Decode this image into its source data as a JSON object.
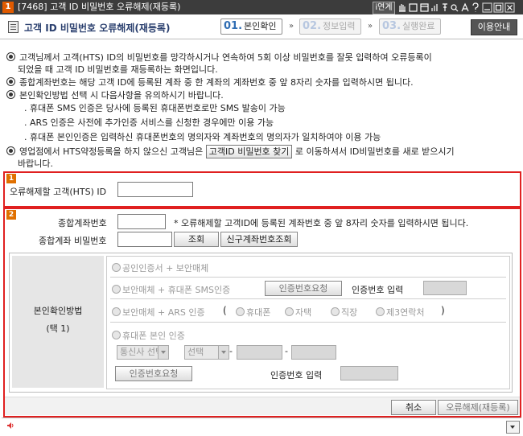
{
  "window": {
    "number": "1",
    "title": "[7468] 고객 ID 비밀번호 오류해제(재등록)",
    "toolbar_label": "i연계",
    "toolbar_icons": [
      "hand-icon",
      "box-icon",
      "square-icon",
      "chart-icon",
      "pin-icon",
      "zoom-icon",
      "letter-a-icon",
      "question-icon",
      "minimize-icon",
      "maximize-icon",
      "close-icon"
    ]
  },
  "header": {
    "page_title": "고객 ID 비밀번호 오류해제(재등록)",
    "steps": [
      {
        "num": "01.",
        "label": "본인확인",
        "active": true
      },
      {
        "num": "02.",
        "label": "정보입력",
        "active": false
      },
      {
        "num": "03.",
        "label": "실행완료",
        "active": false
      }
    ],
    "arrow": "»",
    "guide_button": "이용안내"
  },
  "info": {
    "line1": "고객님께서 고객(HTS) ID의 비밀번호를 망각하시거나 연속하여 5회 이상 비밀번호를 잘못 입력하여 오류등록이",
    "line1b": "되었을 때 고객 ID 비밀번호를 재등록하는 화면입니다.",
    "line2": "종합계좌번호는 해당 고객 ID에 등록된 계좌 중 한 계좌의 계좌번호 중 앞 8자리 숫자를 입력하시면 됩니다.",
    "line3": "본인확인방법 선택 시 다음사항을 유의하시기 바랍니다.",
    "sub1": ". 휴대폰 SMS 인증은 당사에 등록된 휴대폰번호로만 SMS 발송이 가능",
    "sub2": ". ARS 인증은 사전에 추가인증 서비스를 신청한 경우에만 이용 가능",
    "sub3": ". 휴대폰 본인인증은 입력하신 휴대폰번호의 명의자와 계좌번호의 명의자가 일치하여야 이용 가능",
    "line4a": "영업점에서 HTS약정등록을 하지 않으신 고객님은",
    "line4_button": "고객ID 비밀번호 찾기",
    "line4b": "로 이동하셔서 ID비밀번호를 새로 받으시기",
    "line4c": "바랍니다."
  },
  "section1": {
    "badge": "1",
    "label": "오류해제할 고객(HTS) ID",
    "value": ""
  },
  "section2": {
    "badge": "2",
    "account_label": "종합계좌번호",
    "account_value": "",
    "account_note": "* 오류해제할 고객ID에 등록된 계좌번호 중 앞 8자리 숫자를 입력하시면 됩니다.",
    "password_label": "종합계좌 비밀번호",
    "password_value": "",
    "lookup_button": "조회",
    "new_account_button": "신구계좌번호조회",
    "method_label": "본인확인방법",
    "method_choice": "(택 1)",
    "options": {
      "cert": "공인인증서 + 보안매체",
      "sms": "보안매체 + 휴대폰 SMS인증",
      "sms_request_button": "인증번호요청",
      "sms_code_label": "인증번호 입력",
      "ars": "보안매체 + ARS 인증",
      "ars_open": "(",
      "ars_phone": "휴대폰",
      "ars_home": "자택",
      "ars_work": "직장",
      "ars_third": "제3연락처",
      "ars_close": ")",
      "mobile": "휴대폰 본인 인증",
      "carrier_select": "통신사 선택",
      "prefix_select": "선택",
      "dash": "-",
      "mobile_request_button": "인증번호요청",
      "mobile_code_label": "인증번호 입력"
    },
    "cancel_button": "취소",
    "submit_button": "오류해제(재등록)"
  }
}
